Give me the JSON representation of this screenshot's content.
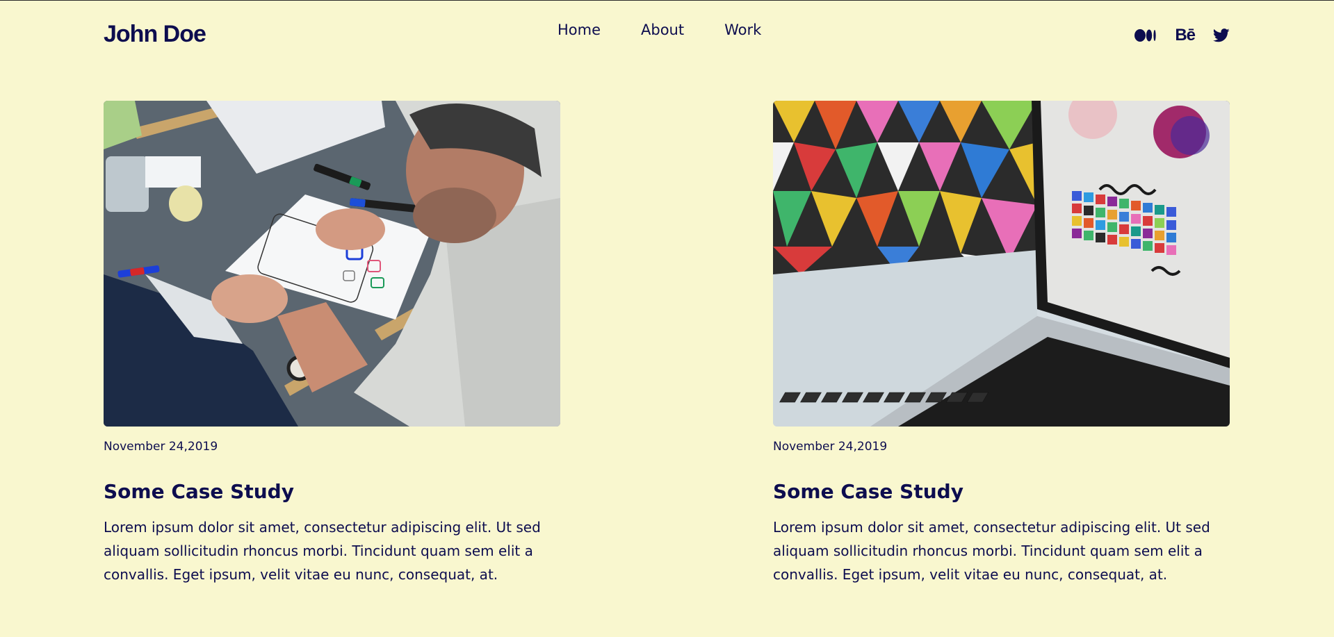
{
  "header": {
    "logo": "John Doe",
    "nav": [
      {
        "label": "Home"
      },
      {
        "label": "About"
      },
      {
        "label": "Work"
      }
    ],
    "social_icons": [
      "medium-icon",
      "behance-icon",
      "twitter-icon"
    ],
    "behance_label": "Bē"
  },
  "cards": [
    {
      "image": "person-sketching-app-icons-photo",
      "date": "November 24,2019",
      "title": "Some Case Study",
      "description": "Lorem ipsum dolor sit amet, consectetur adipiscing elit. Ut sed aliquam sollicitudin rhoncus morbi. Tincidunt quam sem elit a convallis. Eget ipsum, velit vitae eu nunc, consequat, at."
    },
    {
      "image": "laptop-with-colorful-wall-photo",
      "date": "November 24,2019",
      "title": "Some Case Study",
      "description": "Lorem ipsum dolor sit amet, consectetur adipiscing elit. Ut sed aliquam sollicitudin rhoncus morbi. Tincidunt quam sem elit a convallis. Eget ipsum, velit vitae eu nunc, consequat, at."
    }
  ],
  "colors": {
    "background": "#f9f7cf",
    "text": "#0d0d4f"
  }
}
